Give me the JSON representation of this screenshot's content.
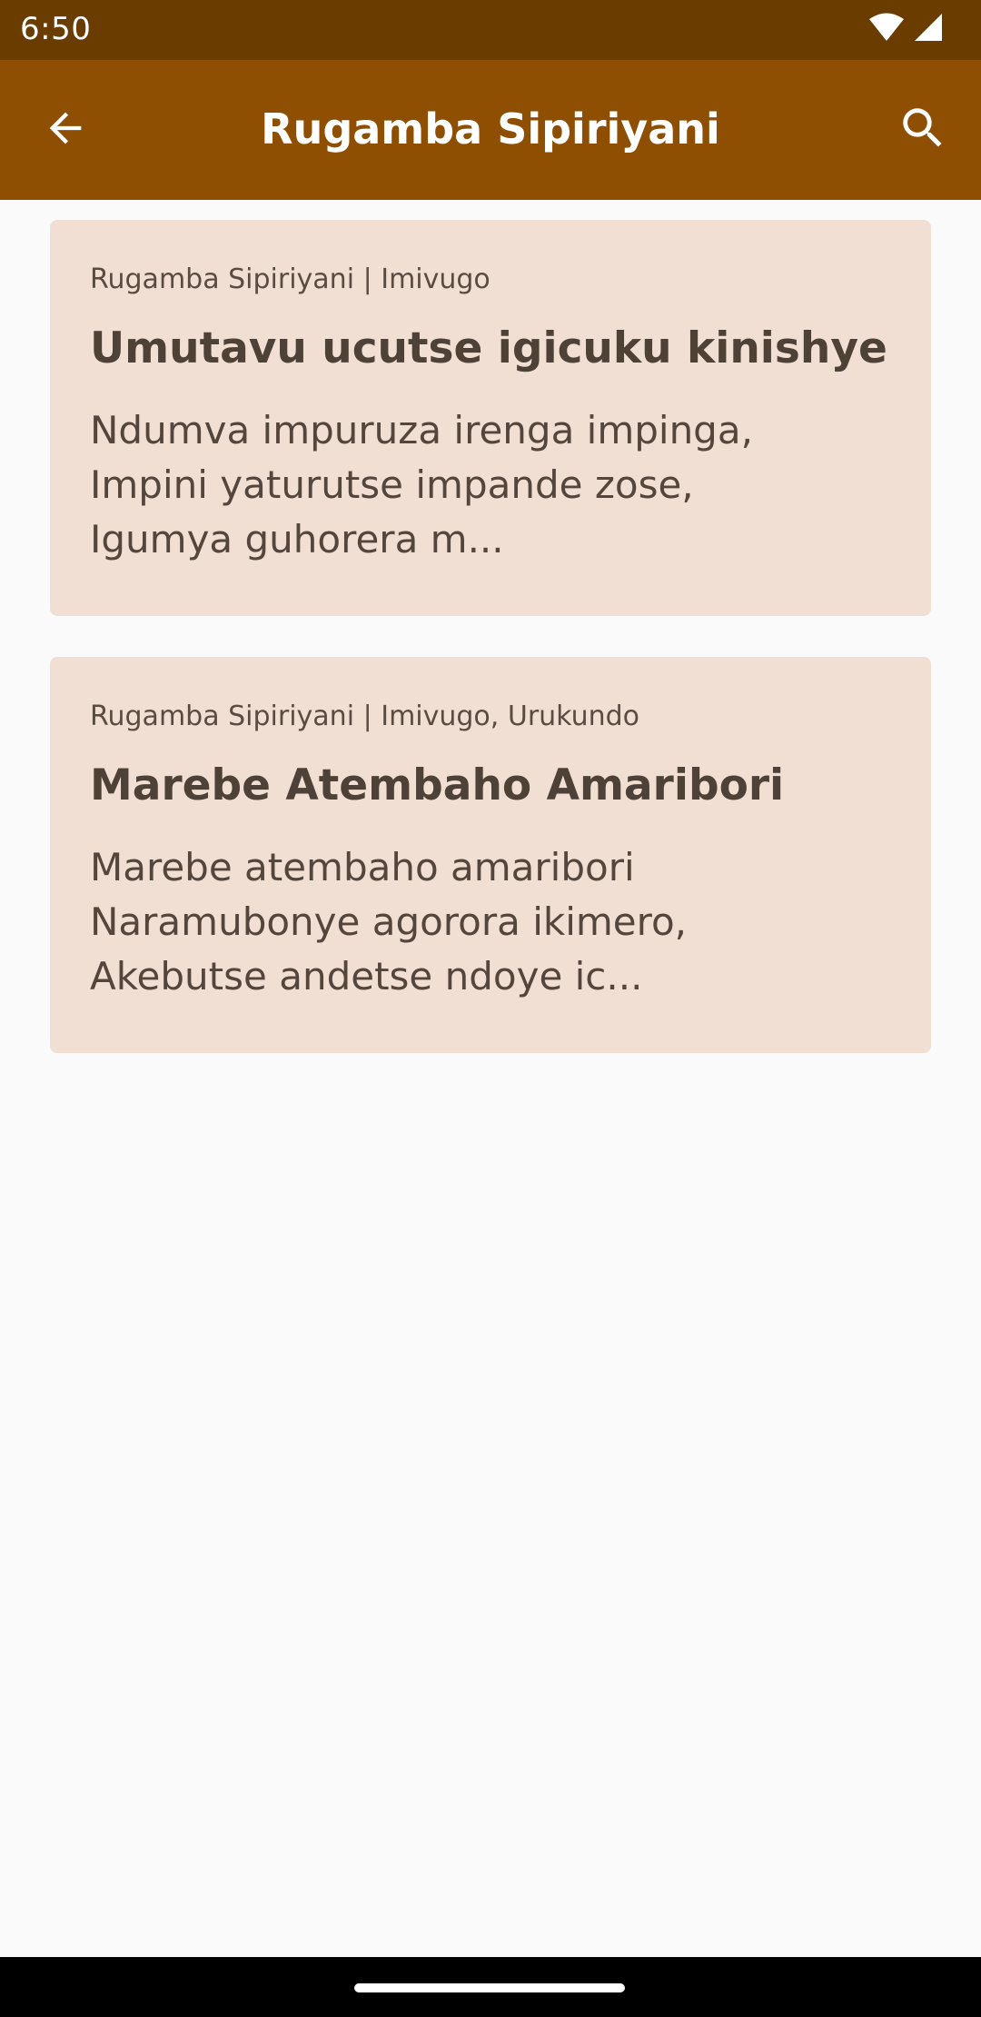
{
  "status_bar": {
    "time": "6:50",
    "icons": [
      "wifi-icon",
      "signal-icon"
    ]
  },
  "app_bar": {
    "title": "Rugamba Sipiriyani",
    "back_icon": "arrow-back-icon",
    "search_icon": "search-icon"
  },
  "colors": {
    "status_bar": "#6b3c00",
    "app_bar": "#8f4f02",
    "card_background": "#f1dfd3",
    "page_background": "#fafafa"
  },
  "posts": [
    {
      "meta": "Rugamba Sipiriyani | Imivugo",
      "title": "Umutavu ucutse igicuku kinishye",
      "excerpt_lines": [
        "Ndumva impuruza irenga impinga,",
        "Impini yaturutse impande zose,",
        "Igumya guhorera m..."
      ]
    },
    {
      "meta": "Rugamba Sipiriyani | Imivugo, Urukundo",
      "title": "Marebe Atembaho Amaribori",
      "excerpt_lines": [
        "Marebe atembaho amaribori",
        "Naramubonye agorora ikimero,",
        "Akebutse andetse ndoye ic..."
      ]
    }
  ]
}
